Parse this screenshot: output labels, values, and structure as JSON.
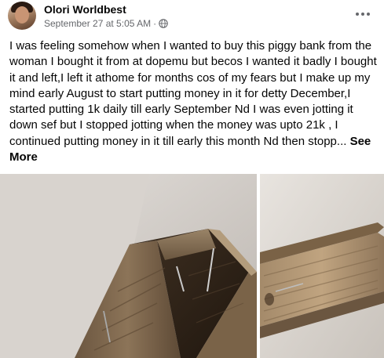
{
  "post": {
    "author": "Olori Worldbest",
    "timestamp": "September 27 at 5:05 AM",
    "separator": "·",
    "privacy_icon": "globe-icon",
    "more_icon": "more-horizontal-icon",
    "text": "I was feeling somehow when I wanted to buy this piggy bank from the woman I bought it from at dopemu but becos I wanted it badly I bought it and left,I left it athome for months  cos of my fears but I make up my mind early August to start putting money in it for detty December,I started putting 1k daily till early September Nd I was even jotting it down sef but I stopped jotting  when the money was upto 21k , I continued putting money in it till early this month Nd then stopp...",
    "see_more_label": "See More"
  },
  "photos": [
    {
      "name": "photo-wooden-box-open",
      "subject": "open wooden piggy bank with nails"
    },
    {
      "name": "photo-wooden-box-side",
      "subject": "side of wooden piggy bank"
    }
  ],
  "colors": {
    "text_primary": "#050505",
    "text_secondary": "#65676b",
    "background": "#ffffff"
  }
}
